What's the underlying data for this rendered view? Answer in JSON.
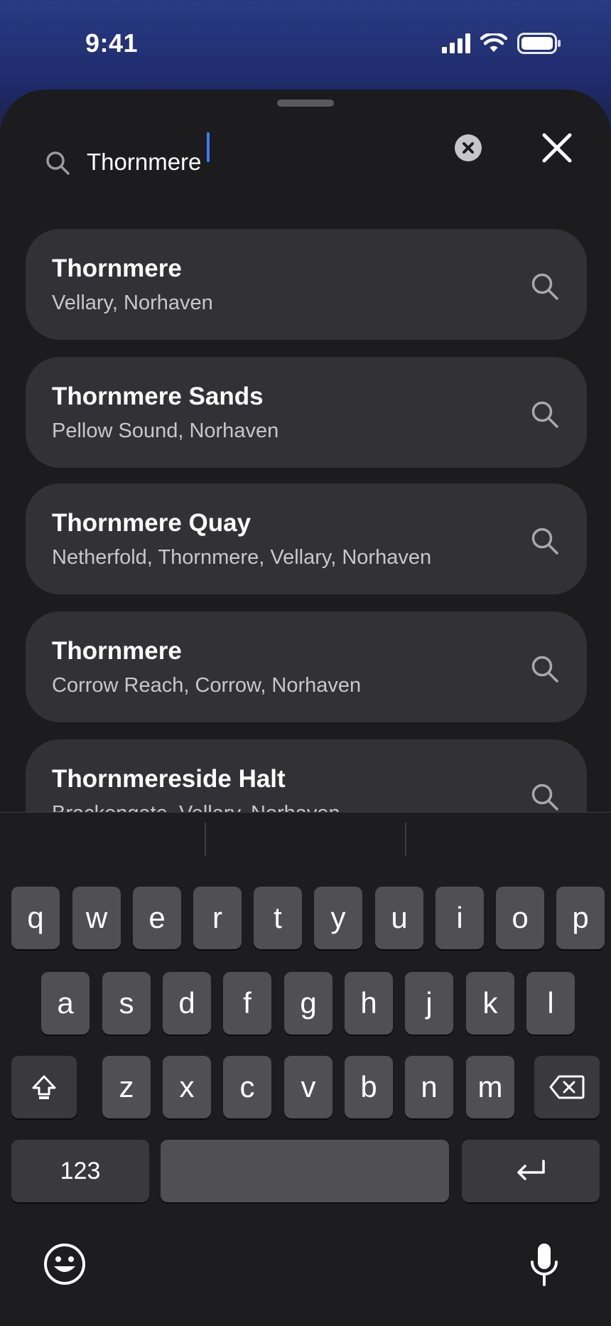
{
  "status_bar": {
    "time": "9:41"
  },
  "search": {
    "value": "Thornmere",
    "clear_icon": "clear-circle-icon",
    "close_icon": "close-icon"
  },
  "results": [
    {
      "title": "Thornmere",
      "subtitle": "Vellary, Norhaven"
    },
    {
      "title": "Thornmere Sands",
      "subtitle": "Pellow Sound, Norhaven"
    },
    {
      "title": "Thornmere Quay",
      "subtitle": "Netherfold, Thornmere, Vellary, Norhaven"
    },
    {
      "title": "Thornmere",
      "subtitle": "Corrow Reach, Corrow, Norhaven"
    },
    {
      "title": "Thornmereside Halt",
      "subtitle": "Brackengate, Vellary, Norhaven"
    }
  ],
  "keyboard": {
    "row1": [
      "q",
      "w",
      "e",
      "r",
      "t",
      "y",
      "u",
      "i",
      "o",
      "p"
    ],
    "row2": [
      "a",
      "s",
      "d",
      "f",
      "g",
      "h",
      "j",
      "k",
      "l"
    ],
    "row3": [
      "z",
      "x",
      "c",
      "v",
      "b",
      "n",
      "m"
    ],
    "numbers_label": "123"
  },
  "colors": {
    "accent_caret": "#3d7bff",
    "card_background": "#323236",
    "sheet_background": "#1c1c1e"
  }
}
